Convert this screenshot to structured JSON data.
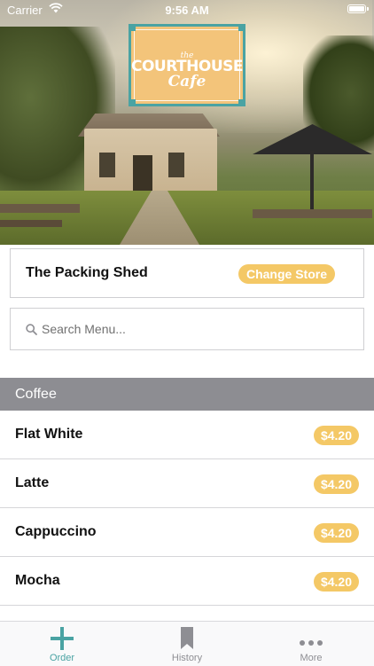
{
  "status_bar": {
    "carrier": "Carrier",
    "time": "9:56 AM"
  },
  "logo": {
    "the": "the",
    "name": "COURTHOUSE",
    "sub": "Cafe"
  },
  "store": {
    "name": "The Packing Shed",
    "change_label": "Change Store"
  },
  "search": {
    "placeholder": "Search Menu..."
  },
  "section": {
    "title": "Coffee"
  },
  "menu_items": [
    {
      "name": "Flat White",
      "price": "$4.20"
    },
    {
      "name": "Latte",
      "price": "$4.20"
    },
    {
      "name": "Cappuccino",
      "price": "$4.20"
    },
    {
      "name": "Mocha",
      "price": "$4.20"
    }
  ],
  "tabs": [
    {
      "label": "Order",
      "icon": "plus-icon",
      "active": true
    },
    {
      "label": "History",
      "icon": "bookmark-icon",
      "active": false
    },
    {
      "label": "More",
      "icon": "more-dots-icon",
      "active": false
    }
  ],
  "colors": {
    "accent": "#4aa3a3",
    "price_badge": "#f4c866",
    "section_header": "#8d8d92",
    "logo_bg": "#f3c47a"
  }
}
